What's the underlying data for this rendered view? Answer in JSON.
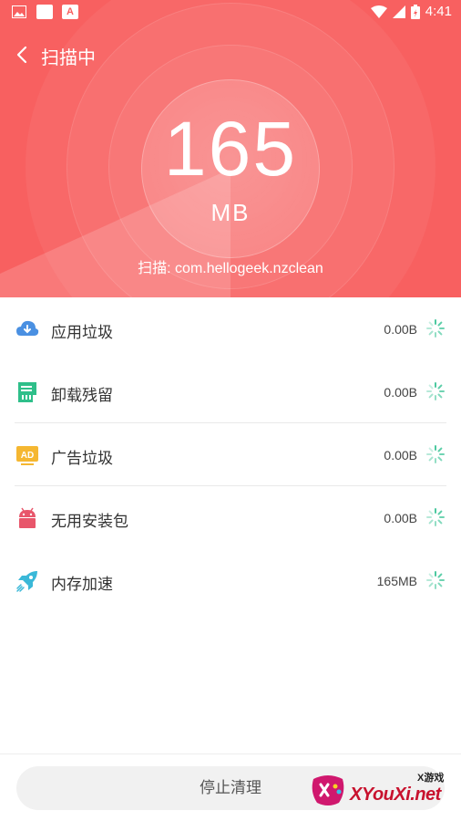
{
  "status_bar": {
    "time": "4:41"
  },
  "header": {
    "title": "扫描中"
  },
  "scan": {
    "size_value": "165",
    "size_unit": "MB",
    "current_item": "扫描: com.hellogeek.nzclean"
  },
  "categories": [
    {
      "label": "应用垃圾",
      "value": "0.00B",
      "icon": "cloud-download-icon",
      "color": "#4a90e2"
    },
    {
      "label": "卸载残留",
      "value": "0.00B",
      "icon": "uninstall-residue-icon",
      "color": "#2fbf8a"
    },
    {
      "label": "广告垃圾",
      "value": "0.00B",
      "icon": "ad-icon",
      "color": "#f5b731"
    },
    {
      "label": "无用安装包",
      "value": "0.00B",
      "icon": "android-package-icon",
      "color": "#e8566b"
    },
    {
      "label": "内存加速",
      "value": "165MB",
      "icon": "rocket-icon",
      "color": "#3ab8d8"
    }
  ],
  "bottom": {
    "stop_button": "停止清理"
  },
  "watermark": {
    "text": "XYouXi.net",
    "top_text": "X游戏"
  },
  "colors": {
    "hero_bg": "#f86060",
    "spinner": "#4cc9a0"
  }
}
